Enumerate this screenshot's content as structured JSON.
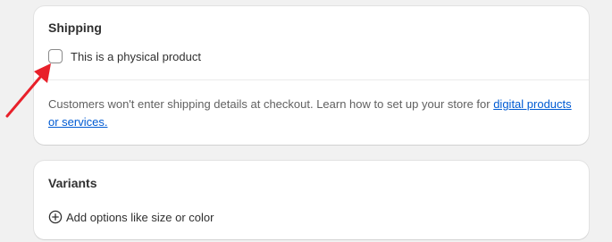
{
  "shipping": {
    "title": "Shipping",
    "physical_checkbox": {
      "label": "This is a physical product",
      "checked": false
    },
    "info_text": "Customers won't enter shipping details at checkout. Learn how to set up your store for ",
    "info_link": "digital products or services."
  },
  "variants": {
    "title": "Variants",
    "add_options_label": "Add options like size or color"
  },
  "annotation": {
    "arrow_color": "#e8202a"
  },
  "colors": {
    "background": "#f1f1f1",
    "card": "#ffffff",
    "link": "#005bd3"
  },
  "icons": {
    "add_options": "plus-circle-icon"
  }
}
